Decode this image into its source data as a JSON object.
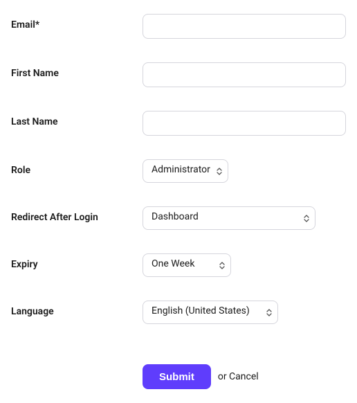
{
  "form": {
    "email": {
      "label": "Email*",
      "value": ""
    },
    "first_name": {
      "label": "First Name",
      "value": ""
    },
    "last_name": {
      "label": "Last Name",
      "value": ""
    },
    "role": {
      "label": "Role",
      "value": "Administrator"
    },
    "redirect": {
      "label": "Redirect After Login",
      "value": "Dashboard"
    },
    "expiry": {
      "label": "Expiry",
      "value": "One Week"
    },
    "language": {
      "label": "Language",
      "value": "English (United States)"
    }
  },
  "actions": {
    "submit": "Submit",
    "or": "or ",
    "cancel": "Cancel"
  }
}
